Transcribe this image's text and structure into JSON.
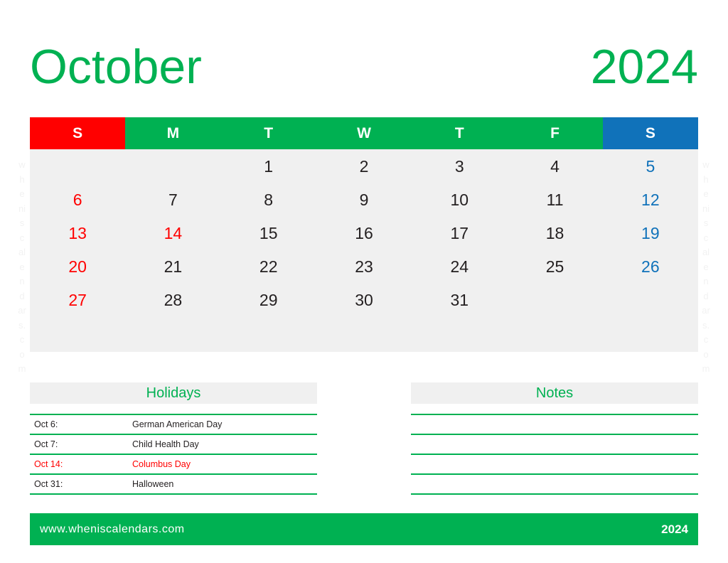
{
  "title": {
    "month": "October",
    "year": "2024"
  },
  "colors": {
    "green": "#00B152",
    "red": "#FF0000",
    "blue": "#1072BA",
    "grid_bg": "#F0F0F0",
    "text": "#231F20",
    "watermark": "#F2F2F2"
  },
  "watermark": {
    "text": "wheniscalendars.com",
    "chars": [
      "w",
      "h",
      "e",
      "ni",
      "s",
      "c",
      "al",
      "e",
      "n",
      "d",
      "ar",
      "s.",
      "c",
      "o",
      "m"
    ]
  },
  "calendar": {
    "weekday_headers": [
      {
        "label": "S",
        "kind": "sun"
      },
      {
        "label": "M",
        "kind": "weekday"
      },
      {
        "label": "T",
        "kind": "weekday"
      },
      {
        "label": "W",
        "kind": "weekday"
      },
      {
        "label": "T",
        "kind": "weekday"
      },
      {
        "label": "F",
        "kind": "weekday"
      },
      {
        "label": "S",
        "kind": "sat"
      }
    ],
    "weeks": [
      [
        {
          "day": "",
          "kind": "empty"
        },
        {
          "day": "",
          "kind": "empty"
        },
        {
          "day": "1",
          "kind": "weekday"
        },
        {
          "day": "2",
          "kind": "weekday"
        },
        {
          "day": "3",
          "kind": "weekday"
        },
        {
          "day": "4",
          "kind": "weekday"
        },
        {
          "day": "5",
          "kind": "sat"
        }
      ],
      [
        {
          "day": "6",
          "kind": "sun"
        },
        {
          "day": "7",
          "kind": "weekday"
        },
        {
          "day": "8",
          "kind": "weekday"
        },
        {
          "day": "9",
          "kind": "weekday"
        },
        {
          "day": "10",
          "kind": "weekday"
        },
        {
          "day": "11",
          "kind": "weekday"
        },
        {
          "day": "12",
          "kind": "sat"
        }
      ],
      [
        {
          "day": "13",
          "kind": "sun"
        },
        {
          "day": "14",
          "kind": "holiday"
        },
        {
          "day": "15",
          "kind": "weekday"
        },
        {
          "day": "16",
          "kind": "weekday"
        },
        {
          "day": "17",
          "kind": "weekday"
        },
        {
          "day": "18",
          "kind": "weekday"
        },
        {
          "day": "19",
          "kind": "sat"
        }
      ],
      [
        {
          "day": "20",
          "kind": "sun"
        },
        {
          "day": "21",
          "kind": "weekday"
        },
        {
          "day": "22",
          "kind": "weekday"
        },
        {
          "day": "23",
          "kind": "weekday"
        },
        {
          "day": "24",
          "kind": "weekday"
        },
        {
          "day": "25",
          "kind": "weekday"
        },
        {
          "day": "26",
          "kind": "sat"
        }
      ],
      [
        {
          "day": "27",
          "kind": "sun"
        },
        {
          "day": "28",
          "kind": "weekday"
        },
        {
          "day": "29",
          "kind": "weekday"
        },
        {
          "day": "30",
          "kind": "weekday"
        },
        {
          "day": "31",
          "kind": "weekday"
        },
        {
          "day": "",
          "kind": "empty"
        },
        {
          "day": "",
          "kind": "empty"
        }
      ],
      [
        {
          "day": "",
          "kind": "empty"
        },
        {
          "day": "",
          "kind": "empty"
        },
        {
          "day": "",
          "kind": "empty"
        },
        {
          "day": "",
          "kind": "empty"
        },
        {
          "day": "",
          "kind": "empty"
        },
        {
          "day": "",
          "kind": "empty"
        },
        {
          "day": "",
          "kind": "empty"
        }
      ]
    ]
  },
  "holidays": {
    "heading": "Holidays",
    "rows": [
      {
        "date": "Oct 6:",
        "label": "German American Day",
        "highlight": false
      },
      {
        "date": "Oct 7:",
        "label": "Child Health Day",
        "highlight": false
      },
      {
        "date": "Oct 14:",
        "label": "Columbus Day",
        "highlight": true
      },
      {
        "date": "Oct 31:",
        "label": "Halloween",
        "highlight": false
      }
    ]
  },
  "notes": {
    "heading": "Notes",
    "line_count": 5
  },
  "footer": {
    "site": "www.wheniscalendars.com",
    "year": "2024"
  }
}
